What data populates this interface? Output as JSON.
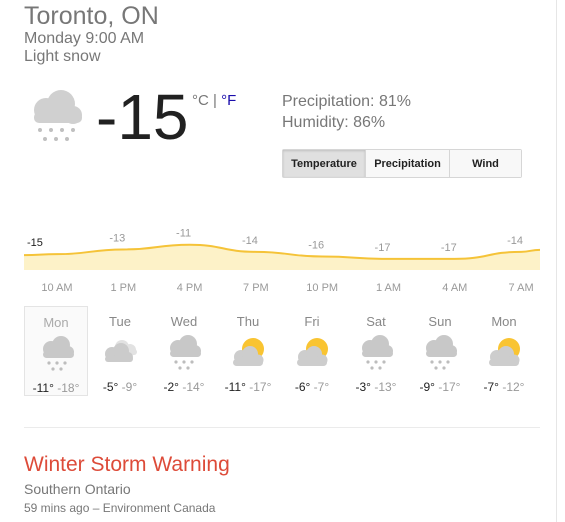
{
  "location": "Toronto, ON",
  "datetime": "Monday 9:00 AM",
  "condition": "Light snow",
  "current_icon": "snow-cloud-icon",
  "temperature": "-15",
  "unit_c": "°C",
  "unit_sep": " | ",
  "unit_f": "°F",
  "precipitation": "Precipitation: 81%",
  "humidity": "Humidity: 86%",
  "tabs": [
    "Temperature",
    "Precipitation",
    "Wind"
  ],
  "selected_tab": "Temperature",
  "colors": {
    "line": "#f5c338",
    "fill": "#fdf2c8",
    "warning": "#dd4b39",
    "link": "#1a0dab"
  },
  "chart_data": {
    "type": "area",
    "x": [
      "10 AM",
      "1 PM",
      "4 PM",
      "7 PM",
      "10 PM",
      "1 AM",
      "4 AM",
      "7 AM"
    ],
    "values": [
      -15,
      -13,
      -11,
      -14,
      -16,
      -17,
      -17,
      -14
    ],
    "ylim": [
      -20,
      -9
    ]
  },
  "forecast": [
    {
      "day": "Mon",
      "icon": "snow-cloud-icon",
      "high": "-11°",
      "low": "-18°"
    },
    {
      "day": "Tue",
      "icon": "cloudy-icon",
      "high": "-5°",
      "low": "-9°"
    },
    {
      "day": "Wed",
      "icon": "snow-cloud-icon",
      "high": "-2°",
      "low": "-14°"
    },
    {
      "day": "Thu",
      "icon": "partly-cloudy-icon",
      "high": "-11°",
      "low": "-17°"
    },
    {
      "day": "Fri",
      "icon": "partly-cloudy-icon",
      "high": "-6°",
      "low": "-7°"
    },
    {
      "day": "Sat",
      "icon": "snow-cloud-icon",
      "high": "-3°",
      "low": "-13°"
    },
    {
      "day": "Sun",
      "icon": "snow-cloud-icon",
      "high": "-9°",
      "low": "-17°"
    },
    {
      "day": "Mon",
      "icon": "partly-cloudy-icon",
      "high": "-7°",
      "low": "-12°"
    }
  ],
  "alert": {
    "title": "Winter Storm Warning",
    "region": "Southern Ontario",
    "source": "59 mins ago – Environment Canada"
  }
}
